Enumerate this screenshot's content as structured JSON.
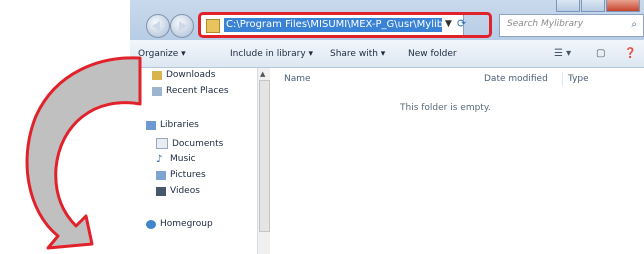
{
  "window": {
    "address_path": "C:\\Program Files\\MISUMI\\MEX-P_G\\usr\\Mylibrary",
    "search_placeholder": "Search Mylibrary"
  },
  "toolbar": {
    "organize_label": "Organize ▾",
    "include_label": "Include in library ▾",
    "share_label": "Share with ▾",
    "new_folder_label": "New folder"
  },
  "nav": {
    "items": [
      {
        "label": "Downloads",
        "icon": "downloads-folder-icon"
      },
      {
        "label": "Recent Places",
        "icon": "recent-places-icon"
      },
      {
        "label": "Libraries",
        "icon": "libraries-icon"
      },
      {
        "label": "Documents",
        "icon": "documents-icon"
      },
      {
        "label": "Music",
        "icon": "music-icon"
      },
      {
        "label": "Pictures",
        "icon": "pictures-icon"
      },
      {
        "label": "Videos",
        "icon": "videos-icon"
      },
      {
        "label": "Homegroup",
        "icon": "homegroup-icon"
      }
    ]
  },
  "content": {
    "columns": [
      "Name",
      "Date modified",
      "Type"
    ],
    "empty_message": "This folder is empty."
  },
  "colors": {
    "highlight": "#e1222b",
    "arrow_outline": "#e1222b",
    "arrow_fill": "#c0c0c0",
    "address_selection": "#3a82d6"
  }
}
